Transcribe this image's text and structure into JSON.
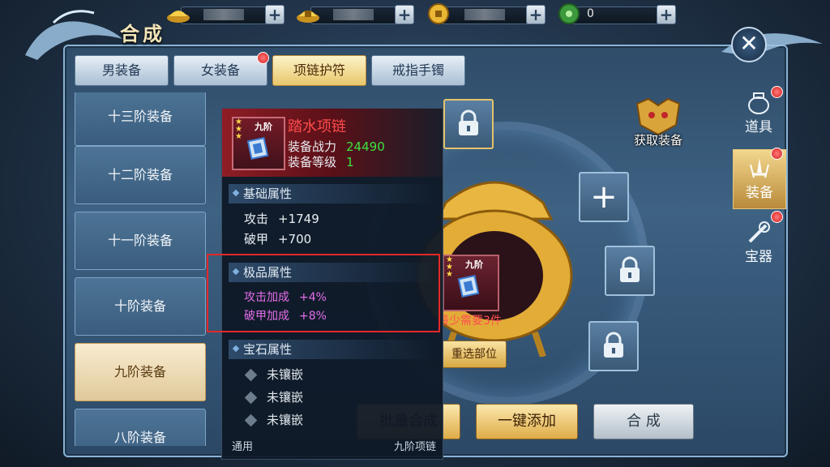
{
  "window": {
    "title": "合成"
  },
  "currencies": [
    {
      "icon": "gold-ingot-icon",
      "value": ""
    },
    {
      "icon": "gold-lock-ingot-icon",
      "value": ""
    },
    {
      "icon": "coin-icon",
      "value": ""
    },
    {
      "icon": "green-jade-icon",
      "value": "0"
    }
  ],
  "tabs": [
    {
      "label": "男装备",
      "badge": false
    },
    {
      "label": "女装备",
      "badge": true
    },
    {
      "label": "项链护符",
      "badge": false,
      "active": true
    },
    {
      "label": "戒指手镯",
      "badge": false
    }
  ],
  "tiers": [
    {
      "label": "十三阶装备"
    },
    {
      "label": "十二阶装备"
    },
    {
      "label": "十一阶装备"
    },
    {
      "label": "十阶装备"
    },
    {
      "label": "九阶装备",
      "active": true
    },
    {
      "label": "八阶装备"
    }
  ],
  "sidenav": [
    {
      "label": "道具",
      "icon": "jar-icon",
      "badge": true
    },
    {
      "label": "装备",
      "icon": "sword-icon",
      "badge": true,
      "active": true
    },
    {
      "label": "宝器",
      "icon": "treasure-icon",
      "badge": true
    }
  ],
  "get_equip_label": "获取装备",
  "need_text": "最少需要3件",
  "reselect_label": "重选部位",
  "buttons": {
    "batch": "批量合成",
    "one_key_add": "一键添加",
    "synthesize": "合 成"
  },
  "tooltip": {
    "tier_badge": "九阶",
    "name": "踏水项链",
    "power_label": "装备战力",
    "power_value": "24490",
    "level_label": "装备等级",
    "level_value": "1",
    "basic": {
      "title": "基础属性",
      "attrs": [
        {
          "name": "攻击",
          "value": "+1749"
        },
        {
          "name": "破甲",
          "value": "+700"
        }
      ]
    },
    "superior": {
      "title": "极品属性",
      "attrs": [
        {
          "name": "攻击加成",
          "value": "+4%"
        },
        {
          "name": "破甲加成",
          "value": "+8%"
        }
      ]
    },
    "gems": {
      "title": "宝石属性",
      "items": [
        "未镶嵌",
        "未镶嵌",
        "未镶嵌"
      ]
    },
    "footer_left": "通用",
    "footer_right": "九阶项链"
  },
  "center_item_tier": "九阶",
  "colors": {
    "accent_gold": "#e8c76c",
    "danger_red": "#ff4b4b",
    "power_green": "#3ee23e",
    "superior_pink": "#e46de8"
  }
}
